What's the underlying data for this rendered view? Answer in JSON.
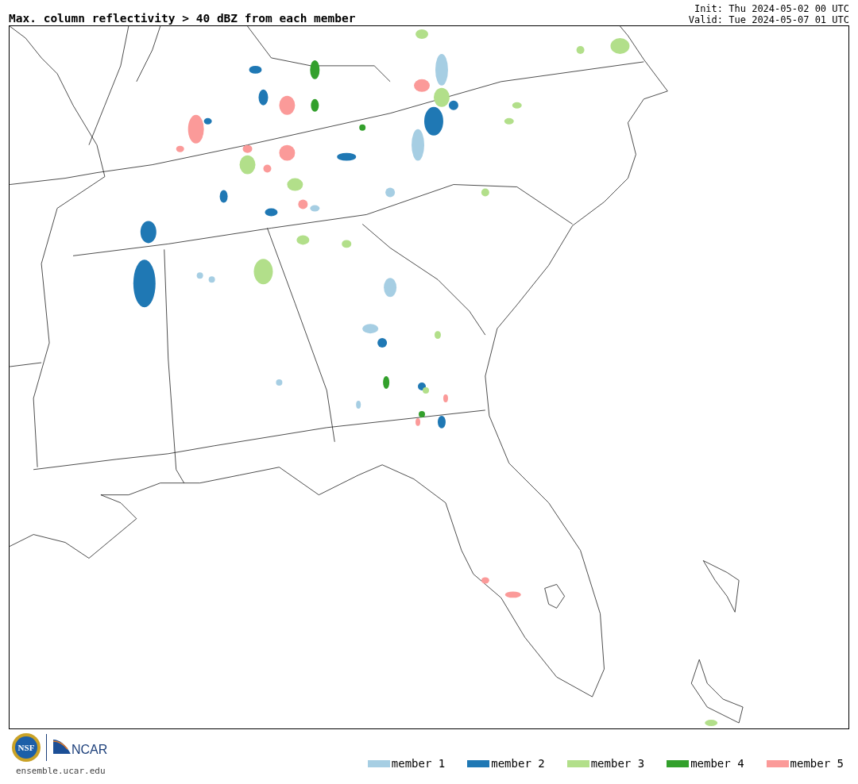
{
  "title": "Max. column reflectivity > 40 dBZ from each member",
  "init": "Init: Thu 2024-05-02 00 UTC",
  "valid": "Valid: Tue 2024-05-07 01 UTC",
  "logos": {
    "nsf": "NSF",
    "ncar": "NCAR",
    "url": "ensemble.ucar.edu"
  },
  "legend": [
    {
      "label": "member 1",
      "color": "#a6cee3"
    },
    {
      "label": "member 2",
      "color": "#1f78b4"
    },
    {
      "label": "member 3",
      "color": "#b2df8a"
    },
    {
      "label": "member 4",
      "color": "#33a02c"
    },
    {
      "label": "member 5",
      "color": "#fb9a99"
    }
  ]
}
